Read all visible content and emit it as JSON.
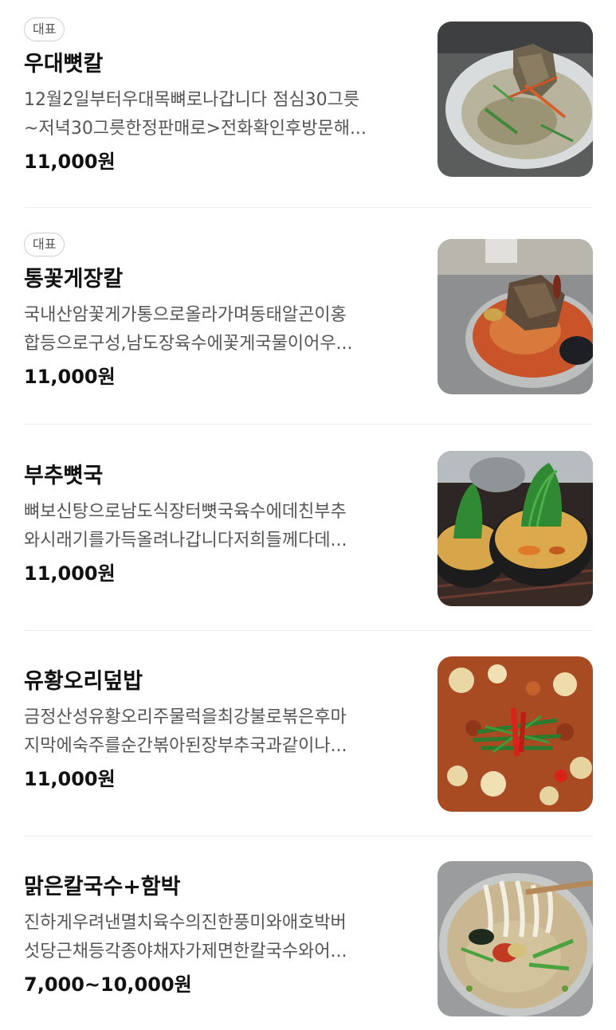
{
  "menu": {
    "items": [
      {
        "badge": "대표",
        "name": "우대뼛칼",
        "desc_line1": "12월2일부터우대목뼈로나갑니다 점심30그릇",
        "desc_line2": "~저녁30그릇한정판매로>전화확인후방문해...",
        "price": "11,000원",
        "image": "우대뼛칼 photo"
      },
      {
        "badge": "대표",
        "name": "통꽃게장칼",
        "desc_line1": "국내산암꽃게가통으로올라가며동태알곤이홍",
        "desc_line2": "합등으로구성,남도장육수에꽃게국물이어우...",
        "price": "11,000원",
        "image": "통꽃게장칼 photo"
      },
      {
        "name": "부추뼛국",
        "desc_line1": "뼈보신탕으로남도식장터뼛국육수에데친부추",
        "desc_line2": "와시래기를가득올려나갑니다저희들께다데...",
        "price": "11,000원",
        "image": "부추뼛국 photo"
      },
      {
        "name": "유황오리덮밥",
        "desc_line1": "금정산성유황오리주물럭을최강불로볶은후마",
        "desc_line2": "지막에숙주를순간볶아된장부추국과같이나...",
        "price": "11,000원",
        "image": "유황오리덮밥 photo"
      },
      {
        "name": "맑은칼국수+함박",
        "desc_line1": "진하게우려낸멸치육수의진한풍미와애호박버",
        "desc_line2": "섯당근채등각종야채자가제면한칼국수와어...",
        "price": "7,000~10,000원",
        "image": "맑은칼국수+함박 photo"
      }
    ]
  }
}
